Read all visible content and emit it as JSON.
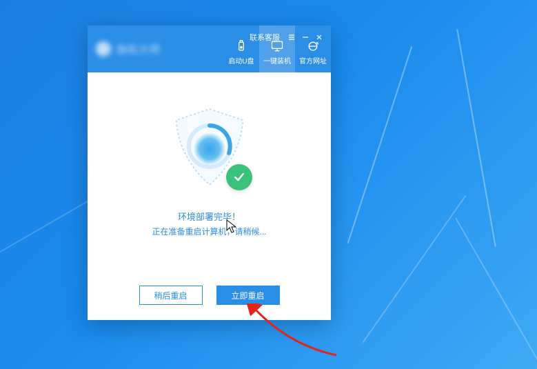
{
  "window": {
    "customer_service": "联系客服",
    "logo_text": "装机大师"
  },
  "tabs": {
    "usb": "启动U盘",
    "install": "一键装机",
    "site": "官方网址"
  },
  "status": {
    "done": "环境部署完毕！",
    "preparing": "正在准备重启计算机，请稍候..."
  },
  "buttons": {
    "later": "稍后重启",
    "now": "立即重启"
  }
}
